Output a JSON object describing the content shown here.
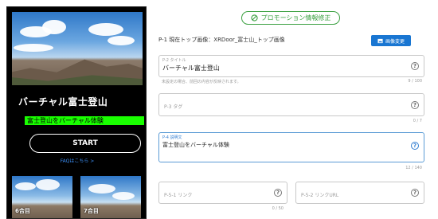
{
  "preview": {
    "title": "バーチャル富士登山",
    "badge": "富士登山をバーチャル体験",
    "start_label": "START",
    "faq_link": "FAQはこちら >",
    "thumbs": [
      {
        "label": "6合目"
      },
      {
        "label": "7合目"
      }
    ]
  },
  "form": {
    "promo_label": "プロモーション情報修正",
    "top_image": {
      "label": "P-1 現在トップ画像：XRDoor_富士山_トップ画像",
      "upload_button": "画像変更"
    },
    "title_field": {
      "label": "P-2 タイトル",
      "value": "バーチャル富士登山",
      "hint": "未設定の場合、前回の内容が反映されます。",
      "counter": "9 / 100"
    },
    "tag_field": {
      "placeholder": "P-3 タグ",
      "counter": "0 / 7"
    },
    "description_field": {
      "label": "P-4 説明文",
      "value": "富士登山をバーチャル体験",
      "counter": "12 / 140"
    },
    "link_field": {
      "placeholder": "P-5-1 リンク",
      "counter": "0 / 50"
    },
    "link_url_field": {
      "placeholder": "P-5-2 リンクURL"
    }
  },
  "colors": {
    "accent_green": "#3aa040",
    "badge_green": "#19ff00",
    "primary_blue": "#1976d2"
  }
}
